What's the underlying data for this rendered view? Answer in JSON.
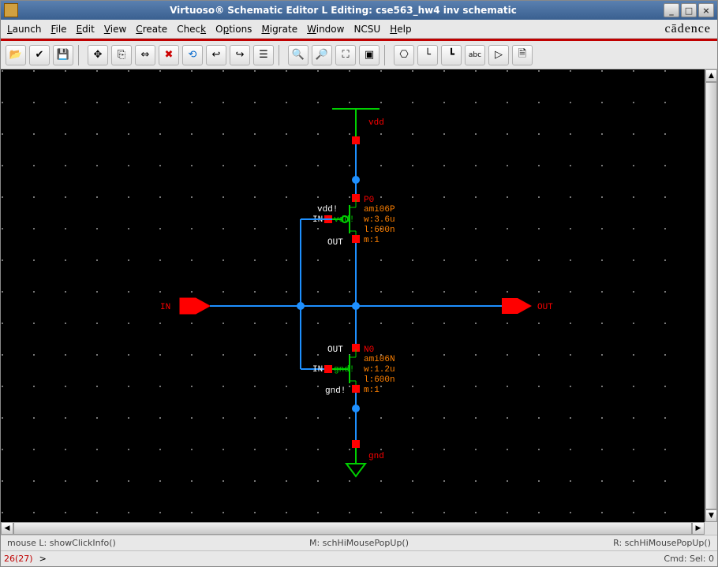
{
  "titlebar": {
    "title": "Virtuoso® Schematic Editor L Editing: cse563_hw4 inv schematic"
  },
  "menu": {
    "launch": "Launch",
    "file": "File",
    "edit": "Edit",
    "view": "View",
    "create": "Create",
    "check": "Check",
    "options": "Options",
    "migrate": "Migrate",
    "window": "Window",
    "ncsu": "NCSU",
    "help": "Help"
  },
  "brand": "cādence",
  "schematic": {
    "pins": {
      "in": "IN",
      "out": "OUT"
    },
    "nets": {
      "vdd": "vdd",
      "gnd": "gnd"
    },
    "pmos": {
      "name": "P0",
      "lib": "ami06P",
      "body": "vdd!",
      "gate_label": "IN",
      "drain_label": "vdd!",
      "source_label": "OUT",
      "w": "w:3.6u",
      "l": "l:600n",
      "m": "m:1"
    },
    "nmos": {
      "name": "N0",
      "lib": "ami06N",
      "body": "gnd!",
      "gate_label": "IN",
      "drain_label": "OUT",
      "source_label": "gnd!",
      "w": "w:1.2u",
      "l": "l:600n",
      "m": "m:1"
    }
  },
  "status": {
    "mouseL": "mouse L: showClickInfo()",
    "mouseM": "M: schHiMousePopUp()",
    "mouseR": "R: schHiMousePopUp()",
    "coords": "26(27)",
    "prompt": ">",
    "cmd": "Cmd: Sel: 0"
  }
}
